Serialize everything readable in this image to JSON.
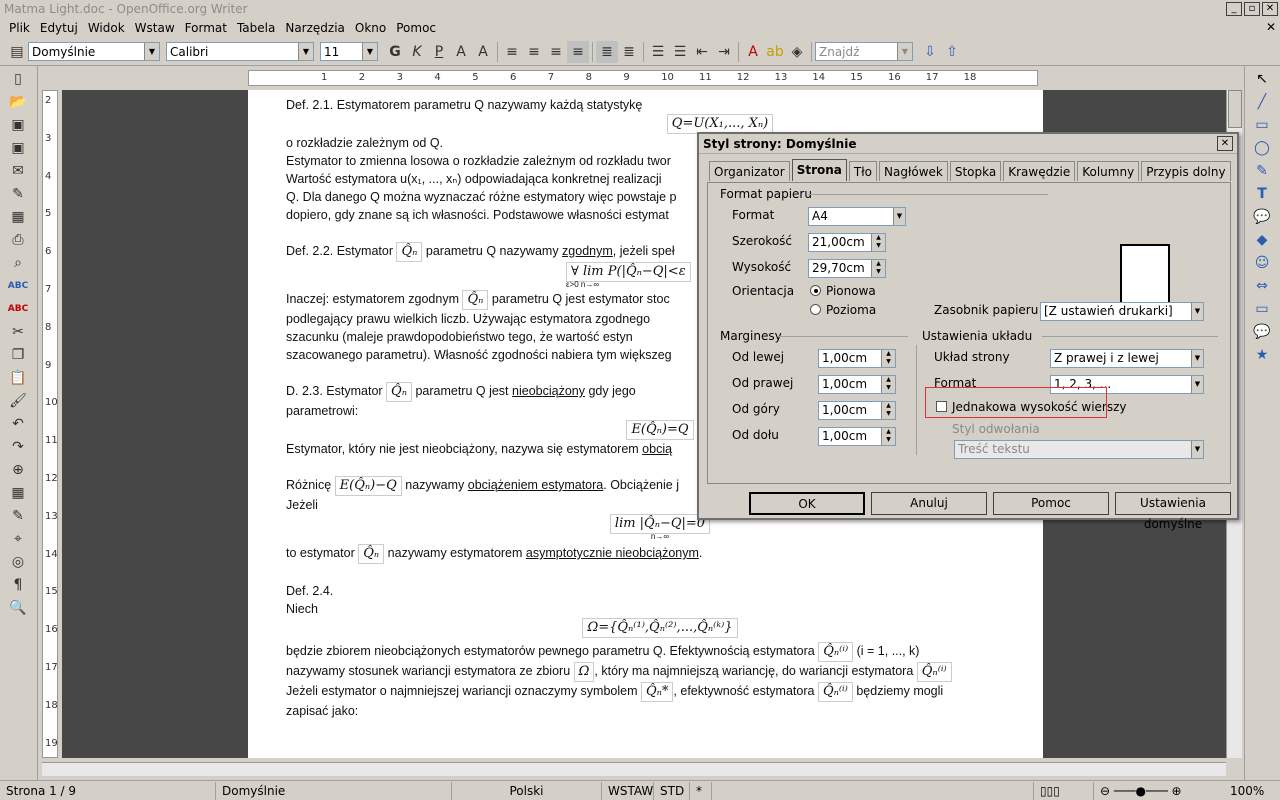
{
  "window": {
    "title": "Matma Light.doc - OpenOffice.org Writer"
  },
  "menu": {
    "items": [
      "Plik",
      "Edytuj",
      "Widok",
      "Wstaw",
      "Format",
      "Tabela",
      "Narzędzia",
      "Okno",
      "Pomoc"
    ],
    "close": "✕"
  },
  "toolbar": {
    "style": "Domyślnie",
    "font": "Calibri",
    "size": "11",
    "search_placeholder": "Znajdź"
  },
  "ruler": {
    "h_ticks": [
      "1",
      "2",
      "3",
      "4",
      "5",
      "6",
      "7",
      "8",
      "9",
      "10",
      "11",
      "12",
      "13",
      "14",
      "15",
      "16",
      "17",
      "18"
    ],
    "v_ticks": [
      "2",
      "3",
      "4",
      "5",
      "6",
      "7",
      "8",
      "9",
      "10",
      "11",
      "12",
      "13",
      "14",
      "15",
      "16",
      "17",
      "18",
      "19"
    ]
  },
  "document": {
    "l1": "Def. 2.1. Estymatorem parametru Q nazywamy każdą statystykę",
    "f1": "Q=U(X₁,..., Xₙ)",
    "l2": "o rozkładzie zależnym od Q.",
    "l3": "Estymator to zmienna losowa o rozkładzie zależnym od rozkładu twor",
    "l4": "Wartość estymatora u(x₁, ..., xₙ) odpowiadająca konkretnej realizacji",
    "l5": "Q. Dla danego Q można wyznaczać różne estymatory więc powstaje p",
    "l6": "dopiero, gdy znane są ich własności. Podstawowe własności estymat",
    "l7a": "Def. 2.2. Estymator ",
    "l7f": "Q̂ₙ",
    "l7b": " parametru Q nazywamy ",
    "l7u": "zgodnym",
    "l7c": ", jeżeli speł",
    "f2": "∀ lim P(|Q̂ₙ−Q|<ε",
    "f2sub": "ε>0 n→∞",
    "l8a": "Inaczej: estymatorem zgodnym ",
    "l8f": "Q̂ₙ",
    "l8b": " parametru Q jest estymator stoc",
    "l9": "podlegający prawu wielkich liczb. Używając estymatora zgodnego",
    "l10": "szacunku (maleje prawdopodobieństwo tego, że wartość estyn",
    "l11": "szacowanego parametru). Własność zgodności nabiera tym większeg",
    "l12a": "D. 2.3. Estymator ",
    "l12f": "Q̂ₙ",
    "l12b": " parametru Q jest ",
    "l12u": "nieobciążony",
    "l12c": " gdy jego",
    "l13": "parametrowi:",
    "f3": "E(Q̂ₙ)=Q",
    "l14a": "Estymator, który nie jest nieobciążony, nazywa się estymatorem ",
    "l14u": "obcią",
    "l15a": "Różnicę ",
    "l15f": "E(Q̂ₙ)−Q",
    "l15b": " nazywamy ",
    "l15u": "obciążeniem estymatora",
    "l15c": ". Obciążenie j",
    "l16": "Jeżeli",
    "f4": "lim |Q̂ₙ−Q|=0",
    "f4sub": "n→∞",
    "l17a": "to estymator ",
    "l17f": "Q̂ₙ",
    "l17b": " nazywamy estymatorem ",
    "l17u": "asymptotycznie nieobciążonym",
    "l17c": ".",
    "l18": "Def. 2.4.",
    "l19": "Niech",
    "f5": "Ω={Q̂ₙ⁽¹⁾,Q̂ₙ⁽²⁾,...,Q̂ₙ⁽ᵏ⁾}",
    "l20a": "będzie zbiorem nieobciążonych estymatorów pewnego parametru Q. Efektywnością estymatora ",
    "l20f": "Q̂ₙ⁽ⁱ⁾",
    "l20b": " (i = 1, ..., k)",
    "l21a": "nazywamy stosunek wariancji estymatora ze zbioru ",
    "l21f": "Ω",
    "l21b": ", który ma najmniejszą wariancję, do wariancji estymatora ",
    "l21f2": "Q̂ₙ⁽ⁱ⁾",
    "l22a": "Jeżeli estymator o najmniejszej wariancji oznaczymy symbolem ",
    "l22f": "Q̂ₙ*",
    "l22b": ", efektywność estymatora ",
    "l22f2": "Q̂ₙ⁽ⁱ⁾",
    "l22c": " będziemy mogli",
    "l23": "zapisać jako:"
  },
  "status": {
    "page": "Strona  1 / 9",
    "style": "Domyślnie",
    "lang": "Polski",
    "insert": "WSTAW",
    "sel": "STD",
    "mod": "*",
    "zoom": "100%"
  },
  "dialog": {
    "title": "Styl strony: Domyślnie",
    "tabs": [
      "Organizator",
      "Strona",
      "Tło",
      "Nagłówek",
      "Stopka",
      "Krawędzie",
      "Kolumny",
      "Przypis dolny"
    ],
    "paper_group": "Format papieru",
    "format_label": "Format",
    "format_value": "A4",
    "width_label": "Szerokość",
    "width_value": "21,00cm",
    "height_label": "Wysokość",
    "height_value": "29,70cm",
    "orientation_label": "Orientacja",
    "portrait": "Pionowa",
    "landscape": "Pozioma",
    "tray_label": "Zasobnik papieru",
    "tray_value": "[Z ustawień drukarki]",
    "margins_group": "Marginesy",
    "left_label": "Od lewej",
    "left_value": "1,00cm",
    "right_label": "Od prawej",
    "right_value": "1,00cm",
    "top_label": "Od góry",
    "top_value": "1,00cm",
    "bottom_label": "Od dołu",
    "bottom_value": "1,00cm",
    "layout_group": "Ustawienia układu",
    "layout_label": "Układ strony",
    "layout_value": "Z prawej i z lewej",
    "numfmt_label": "Format",
    "numfmt_value": "1, 2, 3, ...",
    "register_label": "Jednakowa wysokość wierszy",
    "refstyle_label": "Styl odwołania",
    "refstyle_value": "Treść tekstu",
    "ok": "OK",
    "cancel": "Anuluj",
    "help": "Pomoc",
    "defaults": "Ustawienia domyślne"
  }
}
